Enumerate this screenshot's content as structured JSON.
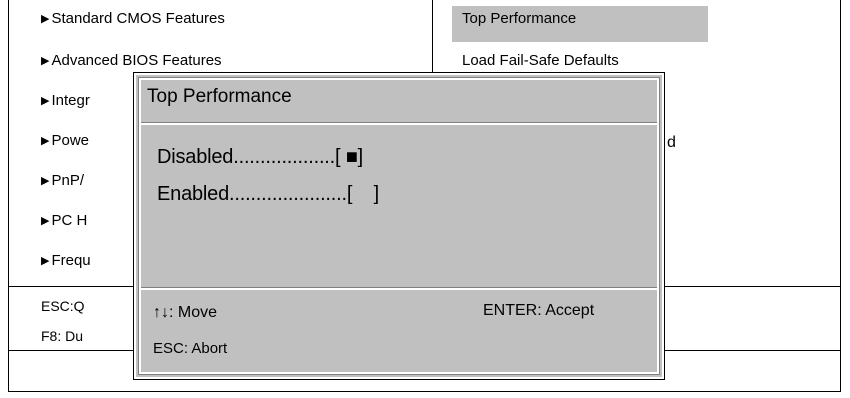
{
  "main_menu": {
    "left_items": [
      "Standard CMOS Features",
      "Advanced BIOS Features",
      "Integr",
      "Powe",
      "PnP/",
      "PC H",
      "Frequ"
    ],
    "right_items": [
      "Top Performance",
      "Load Fail-Safe Defaults",
      "d"
    ],
    "selected_right_item": "Top Performance",
    "hints": [
      "ESC:Q",
      "F8: Du"
    ]
  },
  "dialog": {
    "title": "Top Performance",
    "options": [
      {
        "label": "Disabled",
        "dots": "...................",
        "value": "[ ■]"
      },
      {
        "label": "Enabled",
        "dots": "......................",
        "value": "[    ]"
      }
    ],
    "footer": {
      "move": "↑↓: Move",
      "accept": "ENTER: Accept",
      "abort": "ESC: Abort"
    }
  },
  "colors": {
    "dialog_bg": "#c0c0c0",
    "highlight": "#c0c0c0",
    "page_bg": "#ffffff"
  }
}
